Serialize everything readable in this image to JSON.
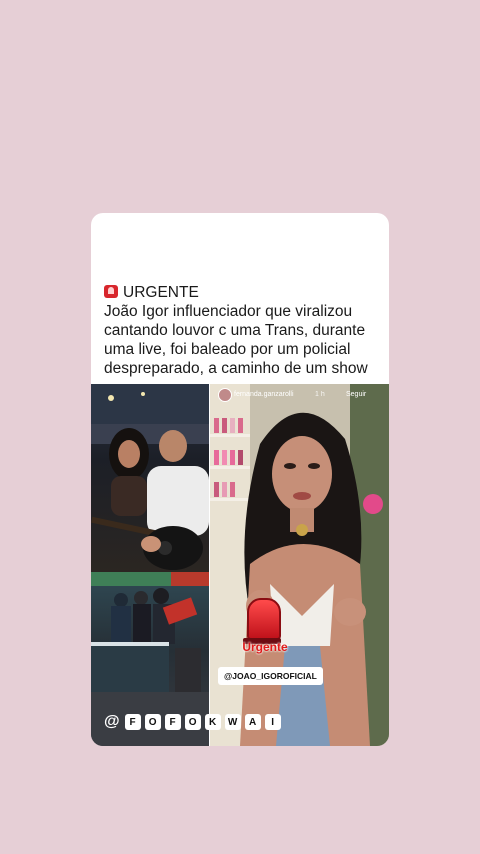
{
  "post": {
    "urgent_emoji_icon": "rotating-light-icon",
    "headline_lines": [
      "URGENTE",
      "João Igor influenciador que viralizou",
      "cantando louvor c uma Trans, durante",
      "uma live, foi baleado por um policial",
      "despreparado, a caminho de um show"
    ]
  },
  "story": {
    "username": "fernanda.ganzarolli",
    "time": "1 h",
    "follow_label": "Seguir",
    "urgente_sticker": "Urgente",
    "handle_tag": "@JOAO_IGOROFICIAL"
  },
  "watermark": {
    "at": "@",
    "letters": [
      "F",
      "O",
      "F",
      "O",
      "K",
      "W",
      "A",
      "I"
    ]
  },
  "colors": {
    "background": "#e6cfd6",
    "card": "#ffffff",
    "alert_red": "#d8262c"
  }
}
